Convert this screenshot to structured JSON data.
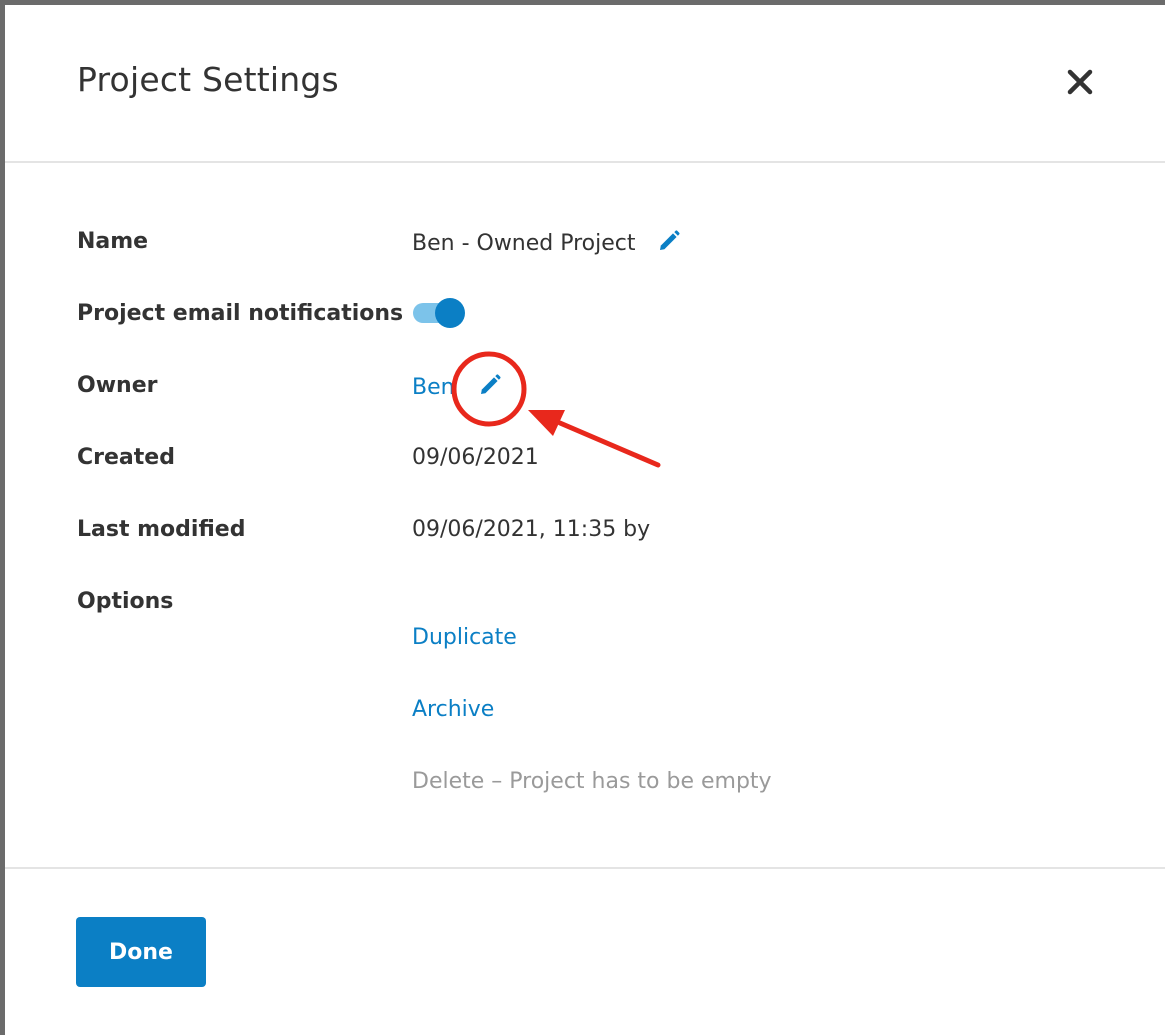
{
  "modal": {
    "title": "Project Settings"
  },
  "fields": {
    "name": {
      "label": "Name",
      "value": "Ben - Owned Project"
    },
    "notifications": {
      "label": "Project email notifications",
      "enabled": true
    },
    "owner": {
      "label": "Owner",
      "value": "Ben"
    },
    "created": {
      "label": "Created",
      "value": "09/06/2021"
    },
    "last_modified": {
      "label": "Last modified",
      "value": "09/06/2021, 11:35 by"
    },
    "options": {
      "label": "Options",
      "duplicate": "Duplicate",
      "archive": "Archive",
      "delete": "Delete – Project has to be empty"
    }
  },
  "footer": {
    "done_label": "Done"
  },
  "icons": {
    "close": "close-icon",
    "edit": "pencil-icon"
  },
  "colors": {
    "accent": "#0b7fc5",
    "toggle_track": "#7cc3ea",
    "annotation": "#e8281c",
    "muted_text": "#9a9a9a"
  }
}
